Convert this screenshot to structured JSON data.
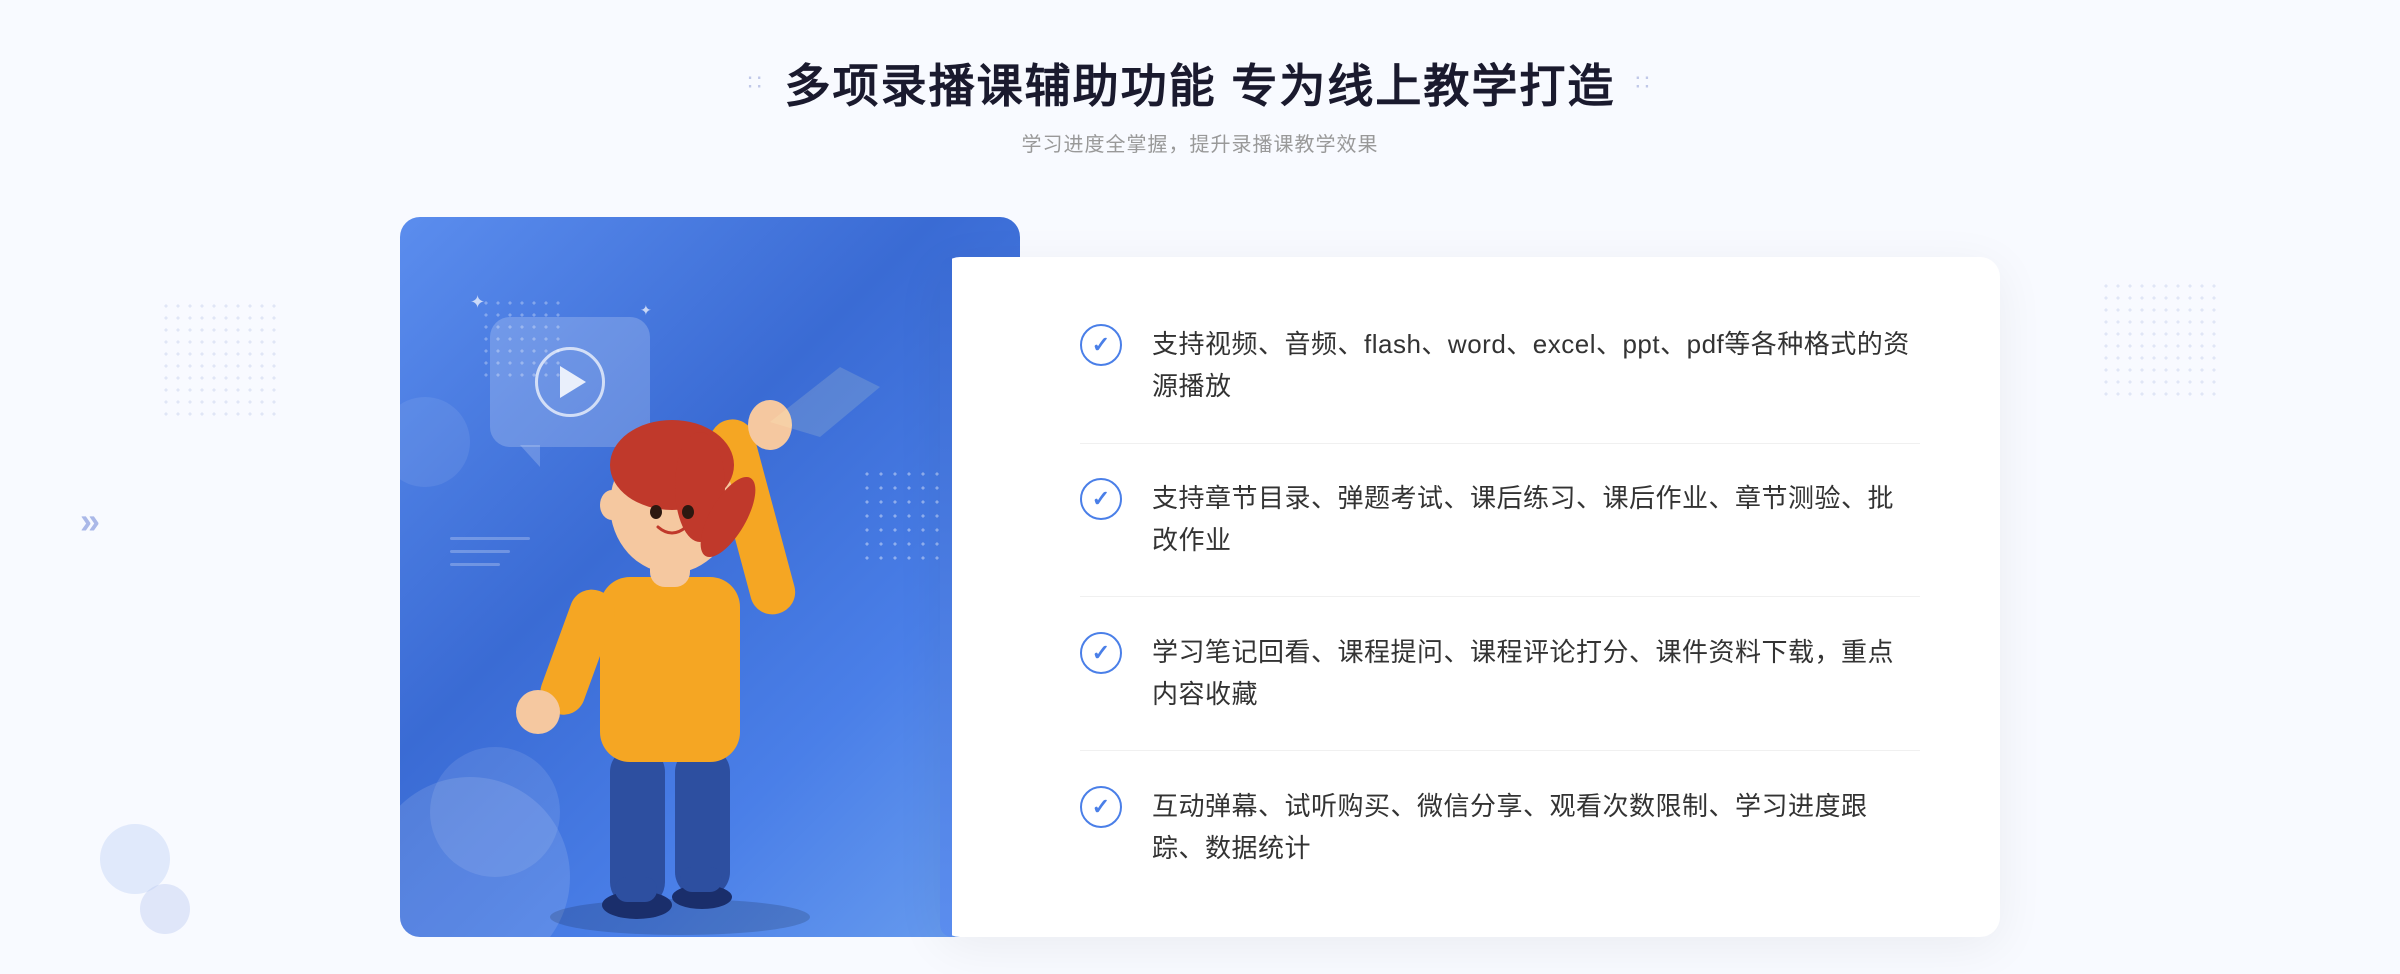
{
  "header": {
    "title": "多项录播课辅助功能 专为线上教学打造",
    "subtitle": "学习进度全掌握，提升录播课教学效果",
    "dots_icon": "∷",
    "dots_icon2": "∷"
  },
  "features": [
    {
      "id": "feature-1",
      "text": "支持视频、音频、flash、word、excel、ppt、pdf等各种格式的资源播放"
    },
    {
      "id": "feature-2",
      "text": "支持章节目录、弹题考试、课后练习、课后作业、章节测验、批改作业"
    },
    {
      "id": "feature-3",
      "text": "学习笔记回看、课程提问、课程评论打分、课件资料下载，重点内容收藏"
    },
    {
      "id": "feature-4",
      "text": "互动弹幕、试听购买、微信分享、观看次数限制、学习进度跟踪、数据统计"
    }
  ],
  "decorative": {
    "arrow": "»",
    "check_symbol": "✓"
  }
}
